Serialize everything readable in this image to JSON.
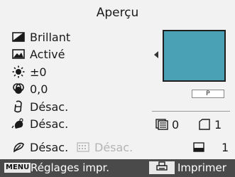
{
  "header": {
    "title": "Aperçu"
  },
  "settings": {
    "paper_type": {
      "icon": "paper-type-icon",
      "value": "Brillant"
    },
    "image_optimize": {
      "icon": "image-optimize-icon",
      "value": "Activé"
    },
    "brightness": {
      "icon": "brightness-icon",
      "value": "±0"
    },
    "color_adjust": {
      "icon": "color-adjust-icon",
      "value": "0,0"
    },
    "face_brightener": {
      "icon": "face-icon",
      "value": "Désac."
    },
    "red_eye": {
      "icon": "red-eye-icon",
      "value": "Désac."
    },
    "noise_reduction": {
      "icon": "noise-reduction-icon",
      "value": "Désac."
    },
    "date_print": {
      "icon": "date-icon",
      "value": "Désac."
    }
  },
  "preview": {
    "paper_label": "P",
    "image_color": "#4aa0b4"
  },
  "info": {
    "image_count": "0",
    "copies": "1",
    "layout_count": "1"
  },
  "bottom_bar": {
    "menu_key": "MENU",
    "settings_label": "Réglages impr.",
    "print_label": "Imprimer"
  }
}
